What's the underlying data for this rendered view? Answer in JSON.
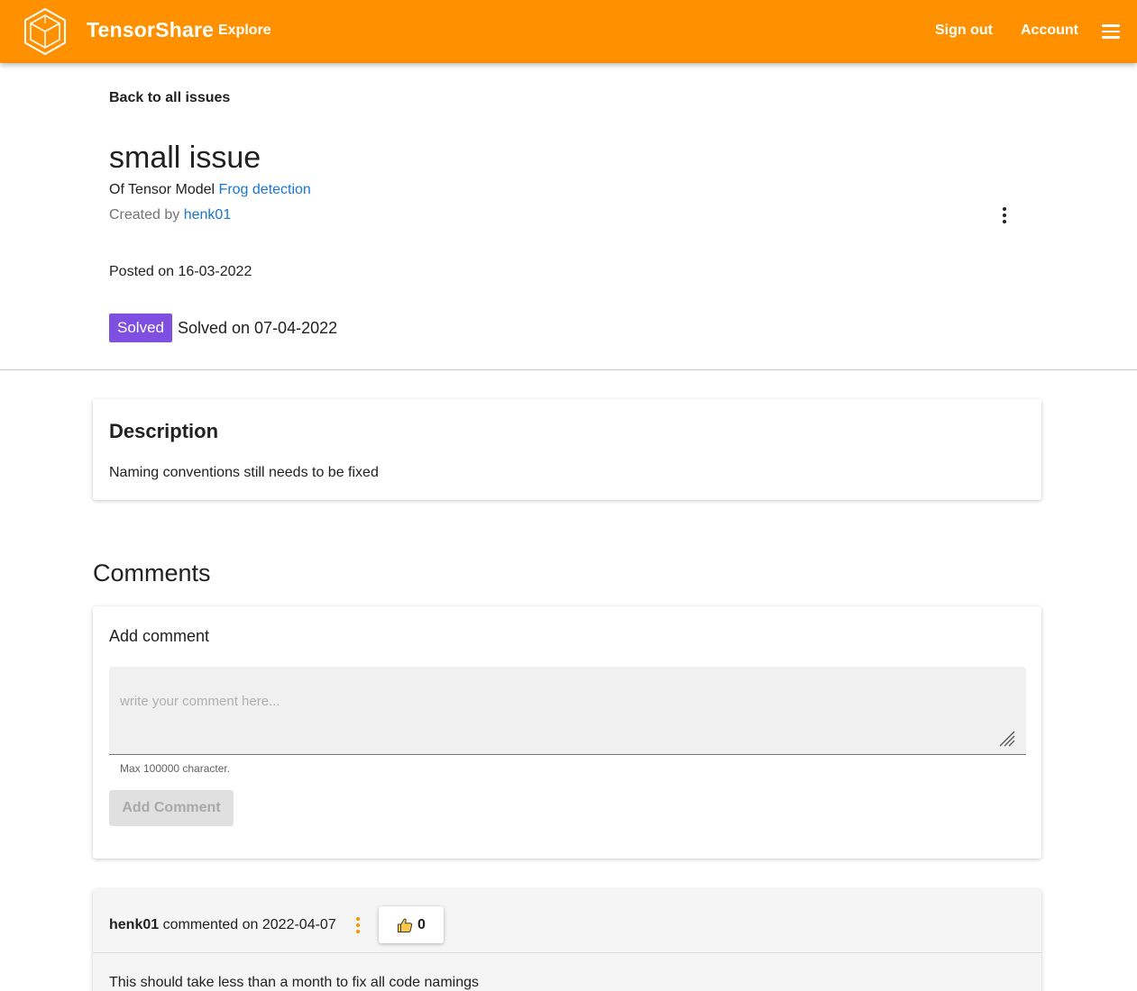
{
  "topbar": {
    "brand": "TensorShare",
    "explore": "Explore",
    "sign_out": "Sign out",
    "account": "Account",
    "logo_icon": "hexagon-cube-icon",
    "menu_icon": "hamburger-menu-icon",
    "color": "#ff9100"
  },
  "issue": {
    "back_link": "Back to all issues",
    "title": "small issue",
    "model_prefix": "Of Tensor Model",
    "model_name": "Frog detection",
    "created_prefix": "Created by",
    "created_by": "henk01",
    "posted_on": "Posted on 16-03-2022",
    "status_badge": "Solved",
    "status_badge_color": "#7e4fe0",
    "solved_on": "Solved on 07-04-2022",
    "options_icon": "more-vertical-icon"
  },
  "description": {
    "title": "Description",
    "text": "Naming conventions still needs to be fixed"
  },
  "comments": {
    "heading": "Comments",
    "add": {
      "title": "Add comment",
      "placeholder": "write your comment here...",
      "value": "",
      "hint": "Max 100000 character.",
      "button": "Add Comment"
    },
    "items": [
      {
        "author": "henk01",
        "date_text": "commented on 2022-04-07",
        "likes": "0",
        "body": "This should take less than a month to fix all code namings"
      }
    ]
  }
}
